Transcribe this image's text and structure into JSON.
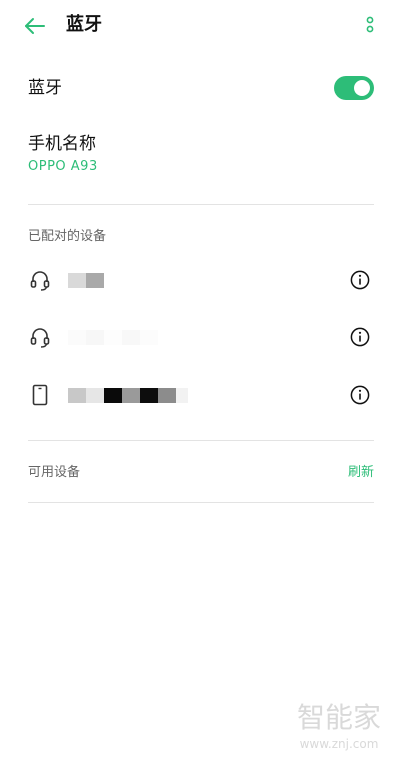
{
  "header": {
    "title": "蓝牙",
    "back_icon": "back-arrow-icon",
    "more_icon": "more-vertical-icon"
  },
  "bluetooth": {
    "label": "蓝牙",
    "enabled": true
  },
  "device_name": {
    "label": "手机名称",
    "value": "OPPO  A93"
  },
  "paired": {
    "header": "已配对的设备",
    "devices": [
      {
        "icon": "headset-icon",
        "name_state": "redacted"
      },
      {
        "icon": "headset-icon",
        "name_state": "redacted"
      },
      {
        "icon": "phone-icon",
        "name_state": "redacted"
      }
    ]
  },
  "available": {
    "header": "可用设备",
    "refresh_label": "刷新"
  },
  "watermark": {
    "text": "智能家",
    "url": "www.znj.com"
  },
  "colors": {
    "accent": "#2dbd78",
    "text": "#111111",
    "secondary": "#666666",
    "divider": "#e3e3e3"
  }
}
